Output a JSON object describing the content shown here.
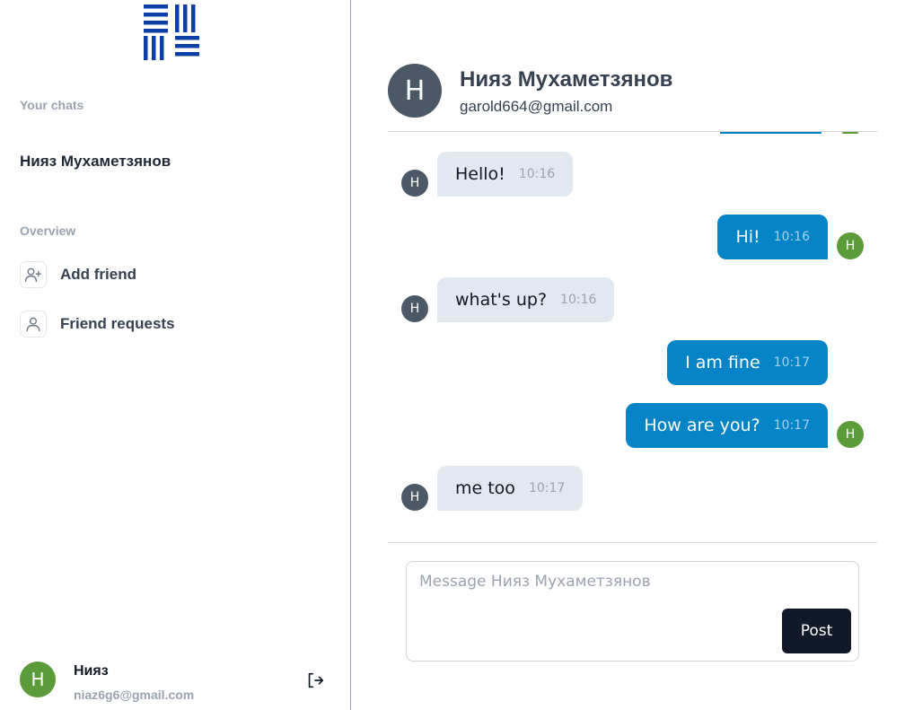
{
  "sidebar": {
    "your_chats_label": "Your chats",
    "chats": [
      {
        "name": "Нияз Мухаметзянов"
      }
    ],
    "overview_label": "Overview",
    "nav": [
      {
        "label": "Add friend",
        "icon": "user-plus-icon"
      },
      {
        "label": "Friend requests",
        "icon": "user-icon"
      }
    ],
    "user": {
      "initial": "H",
      "name": "Нияз",
      "email": "niaz6g6@gmail.com"
    }
  },
  "chat": {
    "partner": {
      "initial": "H",
      "name": "Нияз Мухаметзянов",
      "email": "garold664@gmail.com"
    },
    "messages": [
      {
        "direction": "in",
        "text": "Hello!",
        "time": "10:16",
        "avatar": "H"
      },
      {
        "direction": "out",
        "text": "Hi!",
        "time": "10:16",
        "avatar": "H"
      },
      {
        "direction": "in",
        "text": "what's up?",
        "time": "10:16",
        "avatar": "H"
      },
      {
        "direction": "out",
        "text": "I am fine",
        "time": "10:17"
      },
      {
        "direction": "out",
        "text": "How are you?",
        "time": "10:17",
        "avatar": "H"
      },
      {
        "direction": "in",
        "text": "me too",
        "time": "10:17",
        "avatar": "H"
      }
    ],
    "input": {
      "placeholder": "Message Нияз Мухаметзянов",
      "value": ""
    },
    "post_label": "Post"
  },
  "colors": {
    "accent": "#0284c7",
    "incoming_bubble": "#e2e8f0",
    "partner_avatar": "#4a5965",
    "self_avatar": "#5b9b3a",
    "logo": "#0b3fa6",
    "button": "#111827"
  }
}
